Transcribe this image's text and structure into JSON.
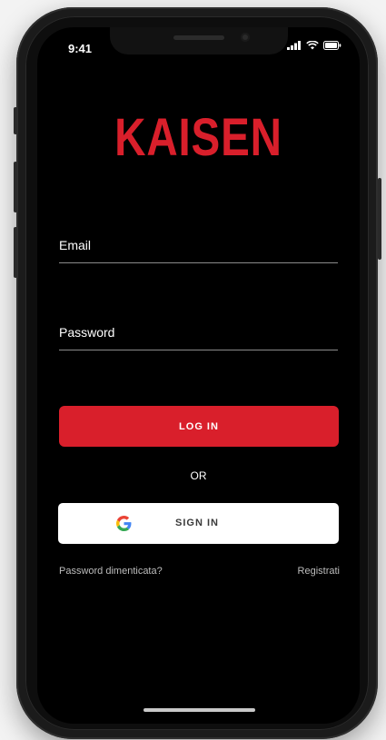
{
  "status_bar": {
    "time": "9:41"
  },
  "brand": {
    "logo_text": "KAISEN",
    "accent_color": "#d91f2b"
  },
  "form": {
    "email_label": "Email",
    "password_label": "Password",
    "login_button": "LOG IN",
    "or_text": "OR",
    "google_button": "SIGN IN"
  },
  "links": {
    "forgot_password": "Password dimenticata?",
    "register": "Registrati"
  },
  "icons": {
    "google": "google-icon",
    "signal": "signal-icon",
    "wifi": "wifi-icon",
    "battery": "battery-icon"
  }
}
